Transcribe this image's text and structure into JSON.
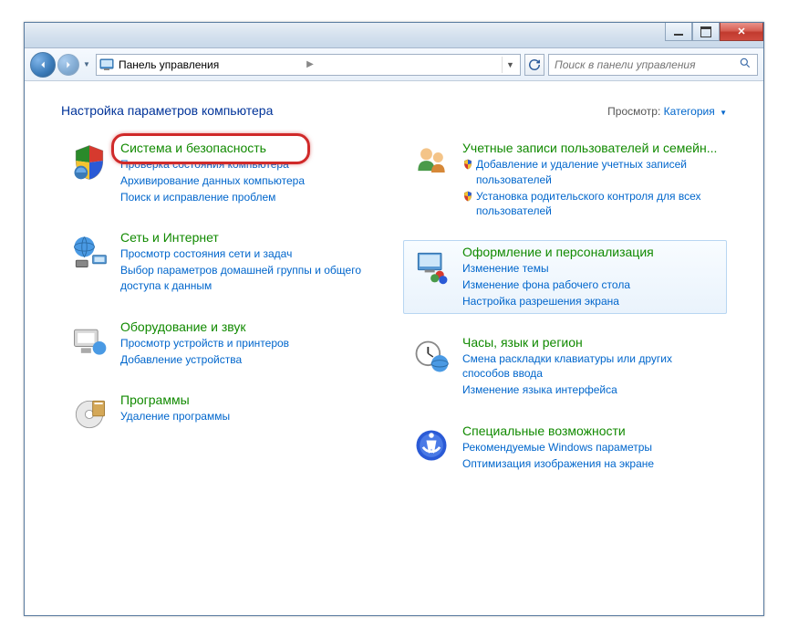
{
  "breadcrumb": {
    "title": "Панель управления"
  },
  "search": {
    "placeholder": "Поиск в панели управления"
  },
  "header": {
    "title": "Настройка параметров компьютера",
    "view_label": "Просмотр:",
    "view_value": "Категория"
  },
  "left": [
    {
      "title": "Система и безопасность",
      "icon": "shield-sec",
      "highlighted": true,
      "subs": [
        {
          "t": "Проверка состояния компьютера",
          "s": false
        },
        {
          "t": "Архивирование данных компьютера",
          "s": false
        },
        {
          "t": "Поиск и исправление проблем",
          "s": false
        }
      ]
    },
    {
      "title": "Сеть и Интернет",
      "icon": "network",
      "subs": [
        {
          "t": "Просмотр состояния сети и задач",
          "s": false
        },
        {
          "t": "Выбор параметров домашней группы и общего доступа к данным",
          "s": false
        }
      ]
    },
    {
      "title": "Оборудование и звук",
      "icon": "hardware",
      "subs": [
        {
          "t": "Просмотр устройств и принтеров",
          "s": false
        },
        {
          "t": "Добавление устройства",
          "s": false
        }
      ]
    },
    {
      "title": "Программы",
      "icon": "programs",
      "subs": [
        {
          "t": "Удаление программы",
          "s": false
        }
      ]
    }
  ],
  "right": [
    {
      "title": "Учетные записи пользователей и семейн...",
      "icon": "users",
      "subs": [
        {
          "t": "Добавление и удаление учетных записей пользователей",
          "s": true
        },
        {
          "t": "Установка родительского контроля для всех пользователей",
          "s": true
        }
      ]
    },
    {
      "title": "Оформление и персонализация",
      "icon": "appearance",
      "hover": true,
      "subs": [
        {
          "t": "Изменение темы",
          "s": false
        },
        {
          "t": "Изменение фона рабочего стола",
          "s": false
        },
        {
          "t": "Настройка разрешения экрана",
          "s": false
        }
      ]
    },
    {
      "title": "Часы, язык и регион",
      "icon": "clock",
      "subs": [
        {
          "t": "Смена раскладки клавиатуры или других способов ввода",
          "s": false
        },
        {
          "t": "Изменение языка интерфейса",
          "s": false
        }
      ]
    },
    {
      "title": "Специальные возможности",
      "icon": "ease",
      "subs": [
        {
          "t": "Рекомендуемые Windows параметры",
          "s": false
        },
        {
          "t": "Оптимизация изображения на экране",
          "s": false
        }
      ]
    }
  ]
}
